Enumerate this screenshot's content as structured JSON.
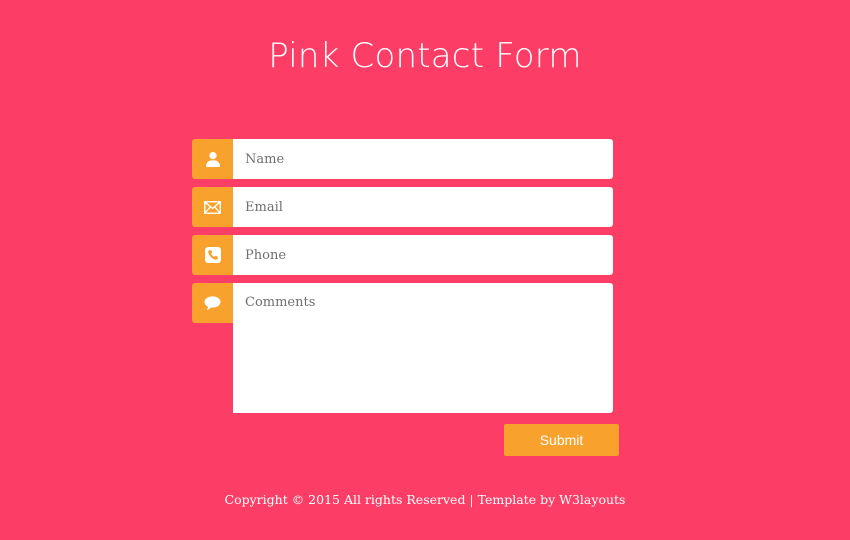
{
  "page": {
    "title": "Pink Contact Form",
    "colors": {
      "background": "#fc3d66",
      "accent": "#f9a12d",
      "field": "#ffffff",
      "text": "#ffffff"
    }
  },
  "form": {
    "fields": [
      {
        "icon": "user-icon",
        "placeholder": "Name",
        "value": ""
      },
      {
        "icon": "envelope-icon",
        "placeholder": "Email",
        "value": ""
      },
      {
        "icon": "phone-icon",
        "placeholder": "Phone",
        "value": ""
      },
      {
        "icon": "speech-bubble-icon",
        "placeholder": "Comments",
        "value": ""
      }
    ],
    "submit_label": "Submit"
  },
  "footer": {
    "text": "Copyright © 2015 All rights Reserved | Template by ",
    "link_text": "W3layouts"
  }
}
